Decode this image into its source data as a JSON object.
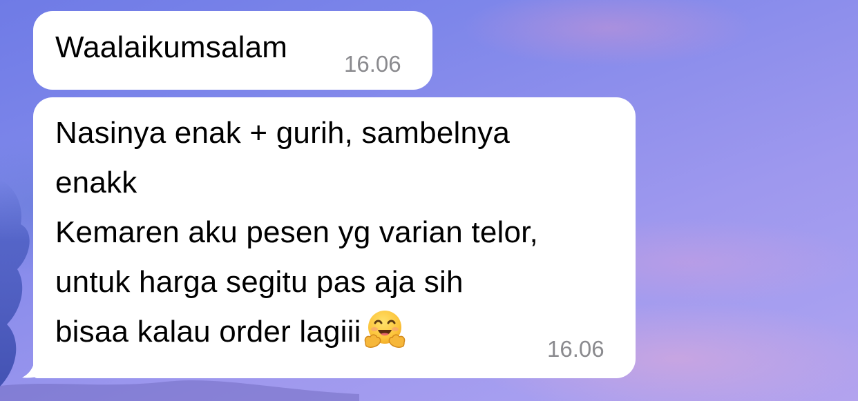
{
  "chat": {
    "messages": [
      {
        "text": "Waalaikumsalam",
        "time": "16.06"
      },
      {
        "lines": [
          "Nasinya enak + gurih, sambelnya",
          "enakk",
          "Kemaren aku pesen yg varian telor,",
          "untuk harga segitu pas aja sih",
          "bisaa kalau order lagiii"
        ],
        "emoji": "hugging-face-emoji",
        "time": "16.06"
      }
    ]
  },
  "colors": {
    "bubble": "#ffffff",
    "timestamp": "#8a8a8e",
    "wallpaper_top": "#6f7be6",
    "wallpaper_bottom": "#b3a3ee"
  }
}
